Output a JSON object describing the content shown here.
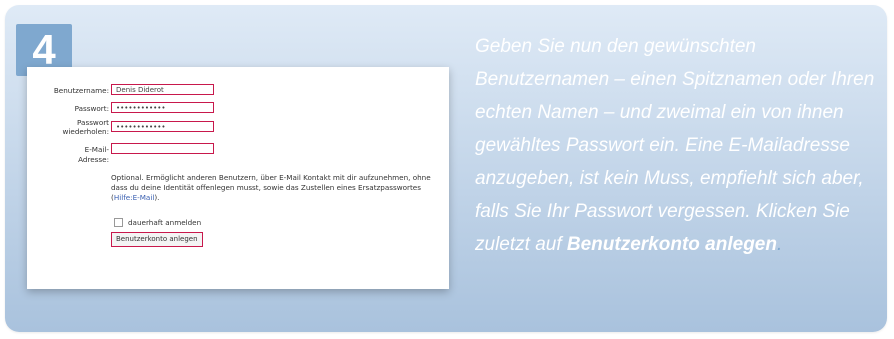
{
  "step": {
    "number": "4"
  },
  "form": {
    "username": {
      "label": "Benutzername:",
      "value": "Denis Diderot"
    },
    "password": {
      "label": "Passwort:",
      "value": "••••••••••••"
    },
    "password_repeat": {
      "label1": "Passwort",
      "label2": "wiederholen:",
      "value": "••••••••••••"
    },
    "email": {
      "label1": "E-Mail-",
      "label2": "Adresse:",
      "value": ""
    },
    "hint": {
      "text": "Optional. Ermöglicht anderen Benutzern, über E-Mail Kontakt mit dir aufzunehmen, ohne dass du deine Identität offenlegen musst, sowie das Zustellen eines Ersatzpasswortes (",
      "link": "Hilfe:E-Mail",
      "end": ")."
    },
    "remember_label": "dauerhaft anmelden",
    "submit_label": "Benutzerkonto anlegen"
  },
  "description": {
    "text": "Geben Sie nun den gewünschten Benutzernamen – einen Spitznamen oder Ihren echten Namen – und zweimal ein von ihnen gewähltes Passwort ein. Eine E-Mailadresse anzugeben, ist kein Muss, empfiehlt sich aber, falls Sie Ihr Passwort vergessen. Klicken Sie zuletzt auf ",
    "emphasis": "Benutzerkonto anlegen",
    "end": "."
  },
  "colors": {
    "badge": "#7fa8cf",
    "highlight": "#c8184c",
    "card_top": "#dfeaf6",
    "card_bottom": "#a9c2dd"
  }
}
